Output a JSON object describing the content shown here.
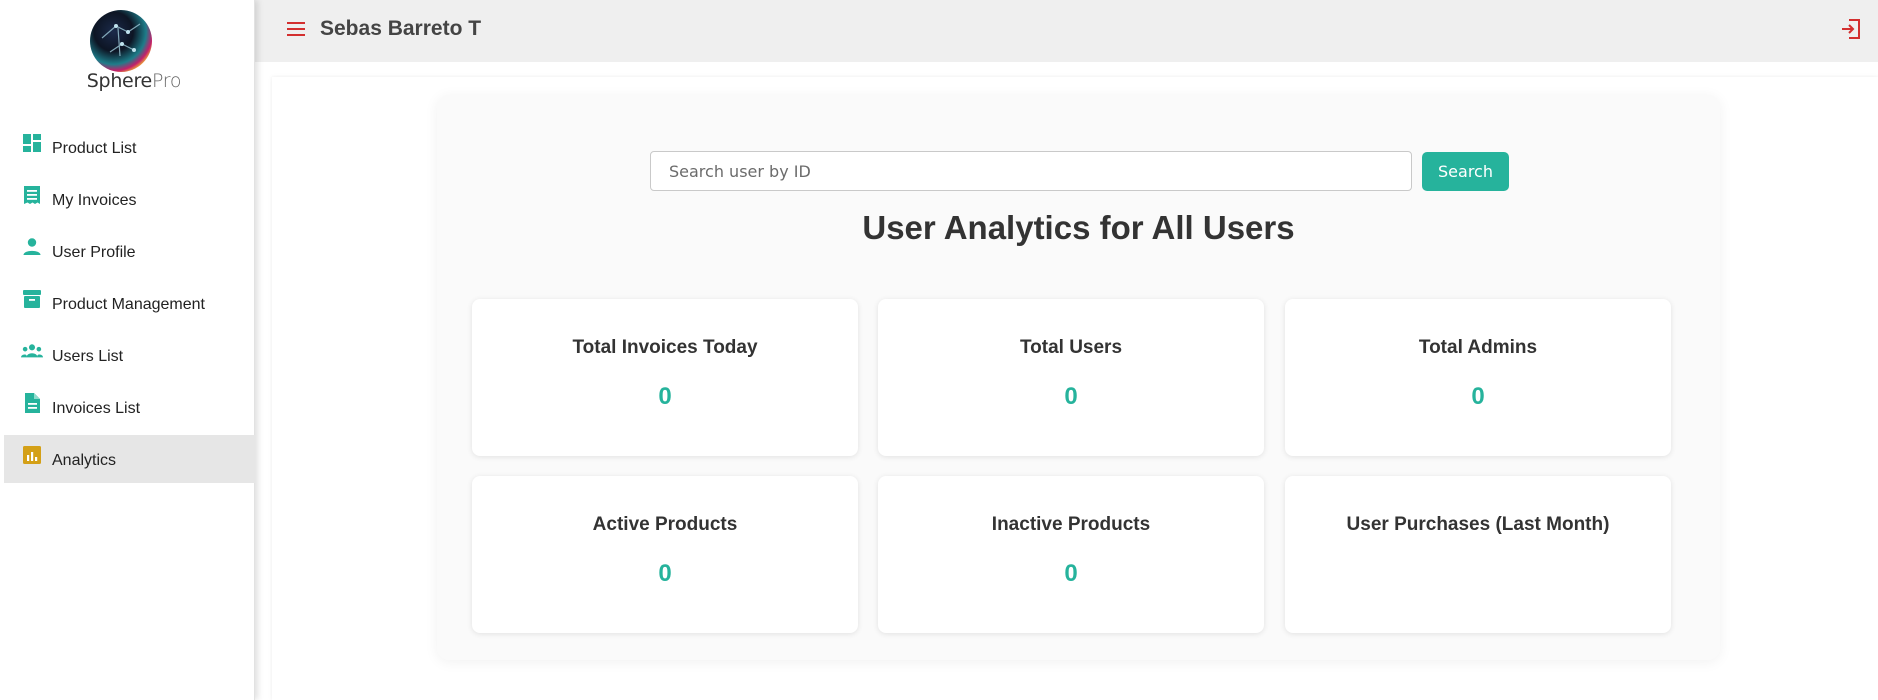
{
  "brand": {
    "name_main": "Sphere",
    "name_suffix": "Pro"
  },
  "sidebar": {
    "items": [
      {
        "label": "Product List",
        "icon": "dashboard-icon"
      },
      {
        "label": "My Invoices",
        "icon": "receipt-icon"
      },
      {
        "label": "User Profile",
        "icon": "person-icon"
      },
      {
        "label": "Product Management",
        "icon": "archive-box-icon"
      },
      {
        "label": "Users List",
        "icon": "group-icon"
      },
      {
        "label": "Invoices List",
        "icon": "document-icon"
      },
      {
        "label": "Analytics",
        "icon": "bar-chart-icon",
        "active": true
      }
    ]
  },
  "topbar": {
    "user_name": "Sebas Barreto T"
  },
  "search": {
    "placeholder": "Search user by ID",
    "value": "",
    "button_label": "Search"
  },
  "main": {
    "title": "User Analytics for All Users",
    "cards": [
      {
        "title": "Total Invoices Today",
        "value": "0"
      },
      {
        "title": "Total Users",
        "value": "0"
      },
      {
        "title": "Total Admins",
        "value": "0"
      },
      {
        "title": "Active Products",
        "value": "0"
      },
      {
        "title": "Inactive Products",
        "value": "0"
      },
      {
        "title": "User Purchases (Last Month)",
        "value": ""
      }
    ]
  },
  "colors": {
    "accent": "#26b39c",
    "menu_red": "#d32f2f",
    "active_icon": "#d4a017"
  }
}
